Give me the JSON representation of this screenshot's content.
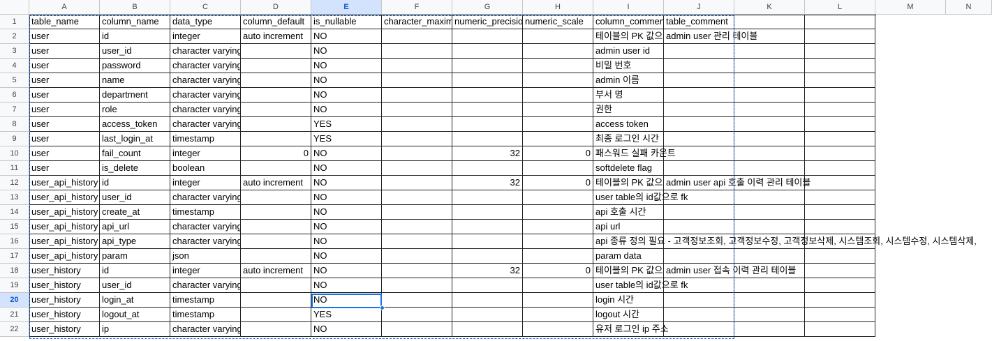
{
  "columns": [
    "A",
    "B",
    "C",
    "D",
    "E",
    "F",
    "G",
    "H",
    "I",
    "J",
    "K",
    "L",
    "M",
    "N"
  ],
  "selected_column": "E",
  "selected_row": 20,
  "rows": [
    [
      "table_name",
      "column_name",
      "data_type",
      "column_default",
      "is_nullable",
      "character_maxim",
      "numeric_precisio",
      "numeric_scale",
      "column_commen",
      "table_comment"
    ],
    [
      "user",
      "id",
      "integer",
      "auto increment",
      "NO",
      "",
      "",
      "",
      "테이블의 PK 값으",
      "admin user 관리 테이블"
    ],
    [
      "user",
      "user_id",
      "character varying",
      "",
      "NO",
      "",
      "",
      "",
      "admin user id",
      ""
    ],
    [
      "user",
      "password",
      "character varying",
      "",
      "NO",
      "",
      "",
      "",
      "비밀 번호",
      ""
    ],
    [
      "user",
      "name",
      "character varying",
      "",
      "NO",
      "",
      "",
      "",
      "admin 이름",
      ""
    ],
    [
      "user",
      "department",
      "character varying",
      "",
      "NO",
      "",
      "",
      "",
      "부서 명",
      ""
    ],
    [
      "user",
      "role",
      "character varying",
      "",
      "NO",
      "",
      "",
      "",
      "권한",
      ""
    ],
    [
      "user",
      "access_token",
      "character varying",
      "",
      "YES",
      "",
      "",
      "",
      "access token",
      ""
    ],
    [
      "user",
      "last_login_at",
      "timestamp",
      "",
      "YES",
      "",
      "",
      "",
      "최종 로그인 시간",
      ""
    ],
    [
      "user",
      "fail_count",
      "integer",
      "0",
      "NO",
      "",
      "32",
      "0",
      "패스워드 실패 카운트",
      ""
    ],
    [
      "user",
      "is_delete",
      "boolean",
      "",
      "NO",
      "",
      "",
      "",
      "softdelete flag",
      ""
    ],
    [
      "user_api_history",
      "id",
      "integer",
      "auto increment",
      "NO",
      "",
      "32",
      "0",
      "테이블의 PK 값으",
      "admin user api 호출 이력 관리 테이블"
    ],
    [
      "user_api_history",
      "user_id",
      "character varying",
      "",
      "NO",
      "",
      "",
      "",
      "user table의 id값으로 fk",
      ""
    ],
    [
      "user_api_history",
      "create_at",
      "timestamp",
      "",
      "NO",
      "",
      "",
      "",
      "api 호출 시간",
      ""
    ],
    [
      "user_api_history",
      "api_url",
      "character varying",
      "",
      "NO",
      "",
      "",
      "",
      "api url",
      ""
    ],
    [
      "user_api_history",
      "api_type",
      "character varying",
      "",
      "NO",
      "",
      "",
      "",
      "api 종류 정의 필요 - 고객정보조회, 고객정보수정, 고객정보삭제, 시스템조회, 시스템수정, 시스템삭제,",
      ""
    ],
    [
      "user_api_history",
      "param",
      "json",
      "",
      "NO",
      "",
      "",
      "",
      "param data",
      ""
    ],
    [
      "user_history",
      "id",
      "integer",
      "auto increment",
      "NO",
      "",
      "32",
      "0",
      "테이블의 PK 값으",
      "admin user 접속 이력 관리 테이블"
    ],
    [
      "user_history",
      "user_id",
      "character varying",
      "",
      "NO",
      "",
      "",
      "",
      "user table의 id값으로 fk",
      ""
    ],
    [
      "user_history",
      "login_at",
      "timestamp",
      "",
      "NO",
      "",
      "",
      "",
      "login 시간",
      ""
    ],
    [
      "user_history",
      "logout_at",
      "timestamp",
      "",
      "YES",
      "",
      "",
      "",
      "logout 시간",
      ""
    ],
    [
      "user_history",
      "ip",
      "character varying",
      "",
      "NO",
      "",
      "",
      "",
      "유저 로그인 ip 주소",
      ""
    ]
  ]
}
